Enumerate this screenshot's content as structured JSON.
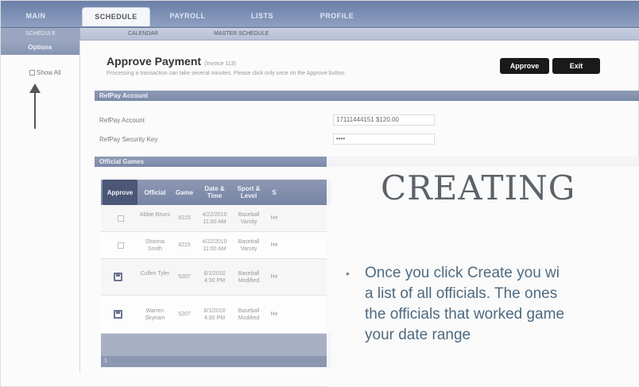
{
  "nav": {
    "tabs": [
      {
        "label": "MAIN"
      },
      {
        "label": "SCHEDULE"
      },
      {
        "label": "PAYROLL"
      },
      {
        "label": "LISTS"
      },
      {
        "label": "PROFILE"
      }
    ]
  },
  "subnav": {
    "items": [
      "SCHEDULE",
      "CALENDAR",
      "MASTER SCHEDULE"
    ]
  },
  "sidebar": {
    "title": "Options",
    "option_label": "Show All"
  },
  "page": {
    "title": "Approve Payment",
    "title_note": "(Invoice 113)",
    "subtitle": "Processing a transaction can take several minutes. Please click only once on the Approve button.",
    "approve_label": "Approve",
    "exit_label": "Exit"
  },
  "refpay": {
    "section_title": "RefPay Account",
    "account_label": "RefPay Account",
    "account_value": "17111444151 $120.00",
    "key_label": "RefPay Security Key",
    "key_value": "••••"
  },
  "officials": {
    "section_title": "Official Games",
    "columns": [
      "Approve",
      "Official",
      "Game",
      "Date & Time",
      "Sport & Level",
      "S"
    ],
    "rows": [
      {
        "official": "Abbie Bruns",
        "game": "8215",
        "datetime": "4/22/2010 11:00 AM",
        "sport": "Baseball Varsity",
        "site": "He",
        "approve": "checkbox"
      },
      {
        "official": "Shonna Smith",
        "game": "8215",
        "datetime": "4/22/2010 11:00 AM",
        "sport": "Baseball Varsity",
        "site": "He",
        "approve": "checkbox"
      },
      {
        "official": "Cullen Tyler",
        "game": "5207",
        "datetime": "6/1/2010 4:30 PM",
        "sport": "Baseball Modified",
        "site": "He",
        "approve": "save"
      },
      {
        "official": "Warren Skyeam",
        "game": "5207",
        "datetime": "6/1/2010 4:30 PM",
        "sport": "Baseball Modified",
        "site": "He",
        "approve": "save"
      }
    ],
    "footer_text": "1"
  },
  "overlay": {
    "heading": "CREATING",
    "bullet_lines": [
      "Once you click Create you wi",
      "a list of all officials. The ones",
      "the officials that worked game",
      "your date range"
    ]
  }
}
